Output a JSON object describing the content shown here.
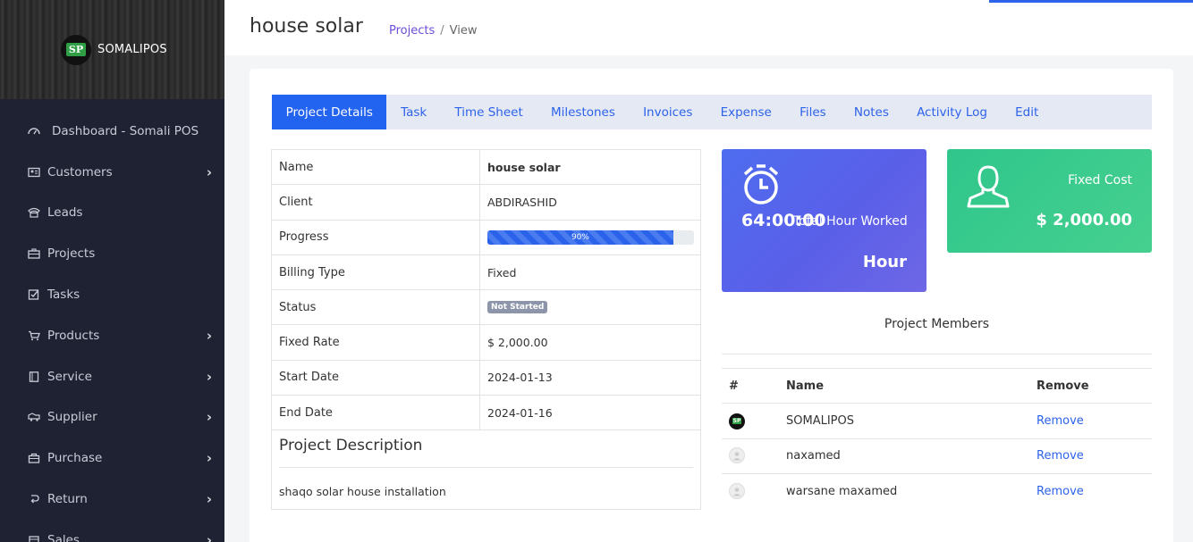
{
  "brand": {
    "logo_text": "SP",
    "name": "SOMALIPOS"
  },
  "sidebar": {
    "items": [
      {
        "label": "Dashboard - Somali POS",
        "icon": "dashboard-icon",
        "chevron": false
      },
      {
        "label": "Customers",
        "icon": "id-card-icon",
        "chevron": true
      },
      {
        "label": "Leads",
        "icon": "phone-icon",
        "chevron": false
      },
      {
        "label": "Projects",
        "icon": "briefcase-icon",
        "chevron": false
      },
      {
        "label": "Tasks",
        "icon": "checkbox-icon",
        "chevron": false
      },
      {
        "label": "Products",
        "icon": "cart-icon",
        "chevron": true
      },
      {
        "label": "Service",
        "icon": "book-icon",
        "chevron": true
      },
      {
        "label": "Supplier",
        "icon": "truck-icon",
        "chevron": true
      },
      {
        "label": "Purchase",
        "icon": "bag-icon",
        "chevron": true
      },
      {
        "label": "Return",
        "icon": "return-icon",
        "chevron": true
      },
      {
        "label": "Sales",
        "icon": "sales-icon",
        "chevron": true
      }
    ]
  },
  "header": {
    "title": "house solar",
    "breadcrumb": {
      "link": "Projects",
      "separator": "/",
      "current": "View"
    }
  },
  "tabs": [
    "Project Details",
    "Task",
    "Time Sheet",
    "Milestones",
    "Invoices",
    "Expense",
    "Files",
    "Notes",
    "Activity Log",
    "Edit"
  ],
  "active_tab": "Project Details",
  "details": {
    "name_label": "Name",
    "name_value": "house solar",
    "client_label": "Client",
    "client_value": "ABDIRASHID",
    "progress_label": "Progress",
    "progress_value": 90,
    "progress_text": "90%",
    "billing_label": "Billing Type",
    "billing_value": "Fixed",
    "status_label": "Status",
    "status_value": "Not Started",
    "rate_label": "Fixed Rate",
    "rate_value": "$ 2,000.00",
    "start_label": "Start Date",
    "start_value": "2024-01-13",
    "end_label": "End Date",
    "end_value": "2024-01-16"
  },
  "description": {
    "heading": "Project Description",
    "text": "shaqo solar house installation"
  },
  "stats": {
    "hours_value": "64:00:00",
    "hours_label": "Total Hour Worked",
    "hours_unit": "Hour",
    "cost_label": "Fixed Cost",
    "cost_value": "$ 2,000.00"
  },
  "members": {
    "title": "Project Members",
    "headers": {
      "index": "#",
      "name": "Name",
      "remove": "Remove"
    },
    "rows": [
      {
        "name": "SOMALIPOS",
        "avatar": "logo",
        "action": "Remove"
      },
      {
        "name": "naxamed",
        "avatar": "blank",
        "action": "Remove"
      },
      {
        "name": "warsane maxamed",
        "avatar": "blank",
        "action": "Remove"
      }
    ]
  },
  "colors": {
    "primary": "#2263f0",
    "sidebar": "#1f2233",
    "green": "#2fc68c",
    "purple_link": "#6d4cd6"
  }
}
